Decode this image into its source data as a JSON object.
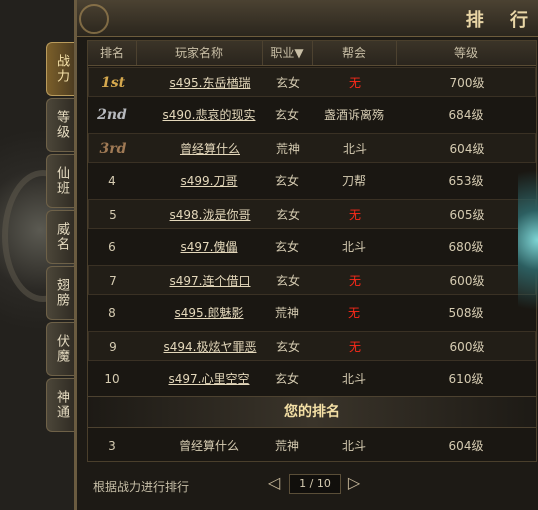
{
  "title": "排 行",
  "tabs": [
    {
      "label": "战力",
      "active": true
    },
    {
      "label": "等级",
      "active": false
    },
    {
      "label": "仙班",
      "active": false
    },
    {
      "label": "威名",
      "active": false
    },
    {
      "label": "翅膀",
      "active": false
    },
    {
      "label": "伏魔",
      "active": false
    },
    {
      "label": "神通",
      "active": false
    }
  ],
  "table": {
    "headers": [
      "排名",
      "玩家名称",
      "职业▼",
      "帮会",
      "等级"
    ],
    "rows": [
      {
        "rank": "1st",
        "name": "s495.东岳楢瑞",
        "class": "玄女",
        "guild": "无",
        "level": "700级"
      },
      {
        "rank": "2nd",
        "name": "s490.悲哀的现实",
        "class": "玄女",
        "guild": "盏酒诉离殇",
        "level": "684级"
      },
      {
        "rank": "3rd",
        "name": "曾经算什么",
        "class": "荒神",
        "guild": "北斗",
        "level": "604级"
      },
      {
        "rank": "4",
        "name": "s499.刀哥",
        "class": "玄女",
        "guild": "刀帮",
        "level": "653级"
      },
      {
        "rank": "5",
        "name": "s498.泷是你哥",
        "class": "玄女",
        "guild": "无",
        "level": "605级"
      },
      {
        "rank": "6",
        "name": "s497.傀儡",
        "class": "玄女",
        "guild": "北斗",
        "level": "680级"
      },
      {
        "rank": "7",
        "name": "s497.连个借口",
        "class": "玄女",
        "guild": "无",
        "level": "600级"
      },
      {
        "rank": "8",
        "name": "s495.郎魅影",
        "class": "荒神",
        "guild": "无",
        "level": "508级"
      },
      {
        "rank": "9",
        "name": "s494.极炫ヤ罪恶",
        "class": "玄女",
        "guild": "无",
        "level": "600级"
      },
      {
        "rank": "10",
        "name": "s497.心里空空",
        "class": "玄女",
        "guild": "北斗",
        "level": "610级"
      }
    ]
  },
  "my_rank": {
    "title": "您的排名",
    "rank": "3",
    "name": "曾经算什么",
    "class": "荒神",
    "guild": "北斗",
    "level": "604级"
  },
  "footer": {
    "note": "根据战力进行排行",
    "page": "1 / 10",
    "prev_icon": "prev-arrow-icon",
    "next_icon": "next-arrow-icon"
  },
  "colors": {
    "none_red": "#ff2a1a",
    "gold": "#d6a94e",
    "silver": "#b7b9bd",
    "bronze": "#a07a55"
  }
}
